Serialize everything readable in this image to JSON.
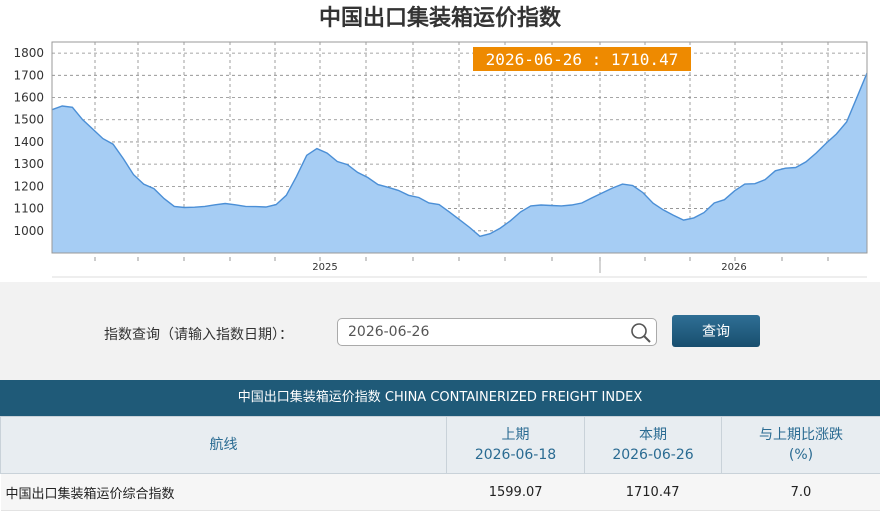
{
  "chart_data": {
    "type": "area",
    "title": "中国出口集装箱运价指数",
    "tooltip": "2026-06-26 : 1710.47",
    "ylim": [
      900,
      1850
    ],
    "yticks": [
      1000,
      1100,
      1200,
      1300,
      1400,
      1500,
      1600,
      1700,
      1800
    ],
    "xtick_labels": [
      "2025",
      "2026"
    ],
    "grid": true,
    "fill_color": "#a6cdf4",
    "line_color": "#4b8fd6",
    "tooltip_color": "#ee8a00",
    "series": [
      {
        "values": [
          1545,
          1562,
          1556,
          1500,
          1458,
          1415,
          1390,
          1325,
          1253,
          1210,
          1190,
          1145,
          1110,
          1105,
          1106,
          1110,
          1117,
          1123,
          1117,
          1110,
          1109,
          1107,
          1118,
          1160,
          1245,
          1340,
          1370,
          1350,
          1312,
          1298,
          1263,
          1240,
          1208,
          1196,
          1182,
          1160,
          1150,
          1125,
          1118,
          1085,
          1050,
          1015,
          975,
          987,
          1012,
          1045,
          1085,
          1112,
          1116,
          1114,
          1112,
          1116,
          1125,
          1148,
          1170,
          1192,
          1210,
          1204,
          1172,
          1124,
          1094,
          1070,
          1048,
          1058,
          1082,
          1125,
          1140,
          1180,
          1210,
          1212,
          1230,
          1270,
          1282,
          1285,
          1310,
          1350,
          1395,
          1436,
          1490,
          1599.07,
          1710.47
        ]
      }
    ]
  },
  "query": {
    "label": "指数查询（请输入指数日期）：",
    "date_value": "2026-06-26",
    "button_label": "查询"
  },
  "table": {
    "caption": "中国出口集装箱运价指数 CHINA CONTAINERIZED FREIGHT INDEX",
    "headers": {
      "route": "航线",
      "prev_label": "上期",
      "prev_date": "2026-06-18",
      "curr_label": "本期",
      "curr_date": "2026-06-26",
      "change_label": "与上期比涨跌",
      "change_unit": "(%)"
    },
    "rows": [
      {
        "route": "中国出口集装箱运价综合指数",
        "prev": "1599.07",
        "curr": "1710.47",
        "change": "7.0"
      }
    ]
  }
}
